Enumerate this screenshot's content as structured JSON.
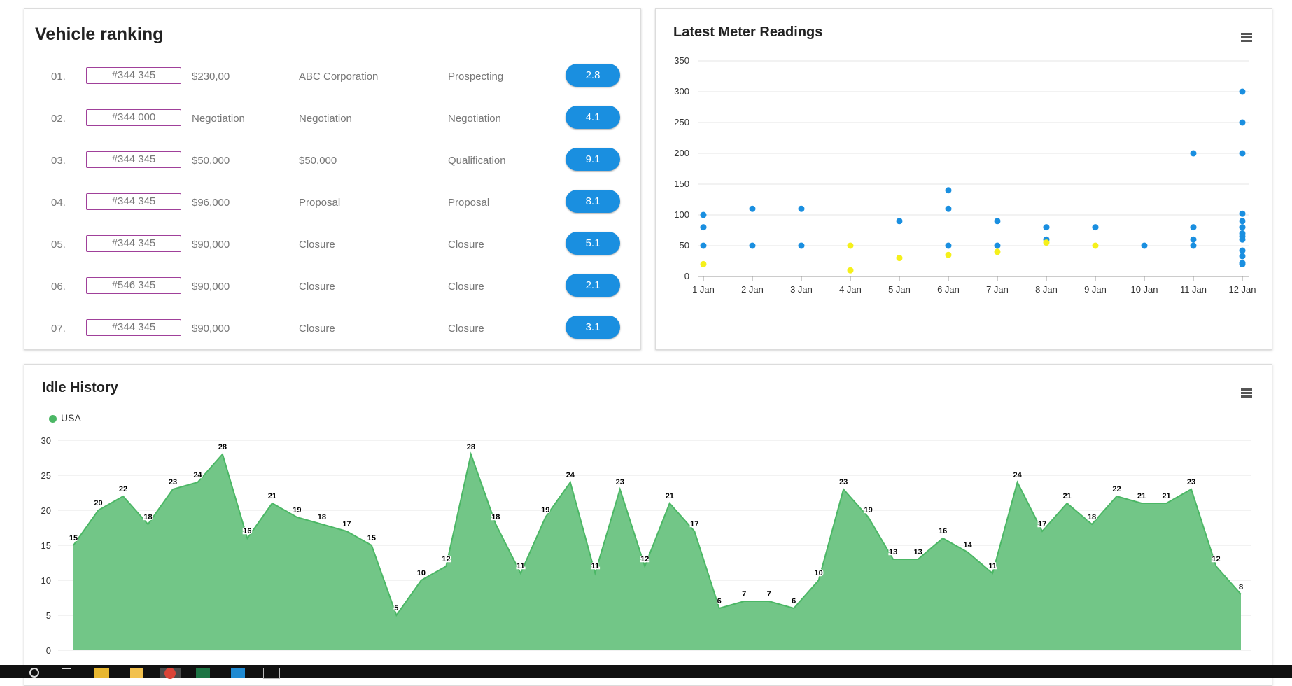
{
  "ranking": {
    "title": "Vehicle ranking",
    "rows": [
      {
        "num": "01.",
        "id": "#344 345",
        "c2": "$230,00",
        "c3": "ABC Corporation",
        "c4": "Prospecting",
        "score": "2.8"
      },
      {
        "num": "02.",
        "id": "#344 000",
        "c2": "Negotiation",
        "c3": "Negotiation",
        "c4": "Negotiation",
        "score": "4.1"
      },
      {
        "num": "03.",
        "id": "#344 345",
        "c2": "$50,000",
        "c3": "$50,000",
        "c4": "Qualification",
        "score": "9.1"
      },
      {
        "num": "04.",
        "id": "#344 345",
        "c2": "$96,000",
        "c3": "Proposal",
        "c4": "Proposal",
        "score": "8.1"
      },
      {
        "num": "05.",
        "id": "#344 345",
        "c2": "$90,000",
        "c3": "Closure",
        "c4": "Closure",
        "score": "5.1"
      },
      {
        "num": "06.",
        "id": "#546 345",
        "c2": "$90,000",
        "c3": "Closure",
        "c4": "Closure",
        "score": "2.1"
      },
      {
        "num": "07.",
        "id": "#344 345",
        "c2": "$90,000",
        "c3": "Closure",
        "c4": "Closure",
        "score": "3.1"
      }
    ]
  },
  "meter": {
    "title": "Latest Meter Readings",
    "colors": {
      "blue": "#1a8fe0",
      "yellow": "#f5f01a"
    }
  },
  "idle": {
    "title": "Idle History",
    "legend": "USA",
    "color": "#4bb765",
    "fill": "#72c687"
  },
  "chart_data": [
    {
      "type": "scatter",
      "title": "Latest Meter Readings",
      "categories": [
        "1 Jan",
        "2 Jan",
        "3 Jan",
        "4 Jan",
        "5 Jan",
        "6 Jan",
        "7 Jan",
        "8 Jan",
        "9 Jan",
        "10 Jan",
        "11 Jan",
        "12 Jan"
      ],
      "ylim": [
        0,
        350
      ],
      "yticks": [
        0,
        50,
        100,
        150,
        200,
        250,
        300,
        350
      ],
      "grid": true,
      "series": [
        {
          "color": "blue",
          "points": [
            [
              0,
              100
            ],
            [
              0,
              80
            ],
            [
              0,
              50
            ],
            [
              1,
              110
            ],
            [
              1,
              50
            ],
            [
              2,
              110
            ],
            [
              2,
              50
            ],
            [
              4,
              90
            ],
            [
              5,
              140
            ],
            [
              5,
              110
            ],
            [
              5,
              50
            ],
            [
              6,
              90
            ],
            [
              6,
              50
            ],
            [
              7,
              80
            ],
            [
              7,
              60
            ],
            [
              8,
              80
            ],
            [
              9,
              50
            ],
            [
              10,
              200
            ],
            [
              10,
              80
            ],
            [
              10,
              60
            ],
            [
              10,
              50
            ],
            [
              11,
              300
            ],
            [
              11,
              250
            ],
            [
              11,
              200
            ],
            [
              11,
              102
            ],
            [
              11,
              90
            ],
            [
              11,
              80
            ],
            [
              11,
              70
            ],
            [
              11,
              65
            ],
            [
              11,
              60
            ],
            [
              11,
              42
            ],
            [
              11,
              33
            ],
            [
              11,
              22
            ],
            [
              11,
              20
            ]
          ]
        },
        {
          "color": "yellow",
          "points": [
            [
              0,
              20
            ],
            [
              3,
              50
            ],
            [
              3,
              10
            ],
            [
              4,
              30
            ],
            [
              5,
              35
            ],
            [
              6,
              40
            ],
            [
              7,
              55
            ],
            [
              8,
              50
            ]
          ]
        }
      ]
    },
    {
      "type": "area",
      "title": "Idle History",
      "ylim": [
        0,
        30
      ],
      "yticks": [
        0,
        5,
        10,
        15,
        20,
        25,
        30
      ],
      "grid": true,
      "legend": "top-left",
      "series": [
        {
          "name": "USA",
          "values": [
            15,
            20,
            22,
            18,
            23,
            24,
            28,
            16,
            21,
            19,
            18,
            17,
            15,
            5,
            10,
            12,
            28,
            18,
            11,
            19,
            24,
            11,
            23,
            12,
            21,
            17,
            6,
            7,
            7,
            6,
            10,
            23,
            19,
            13,
            13,
            16,
            14,
            11,
            24,
            17,
            21,
            18,
            22,
            21,
            21,
            23,
            12,
            8
          ]
        }
      ]
    }
  ]
}
